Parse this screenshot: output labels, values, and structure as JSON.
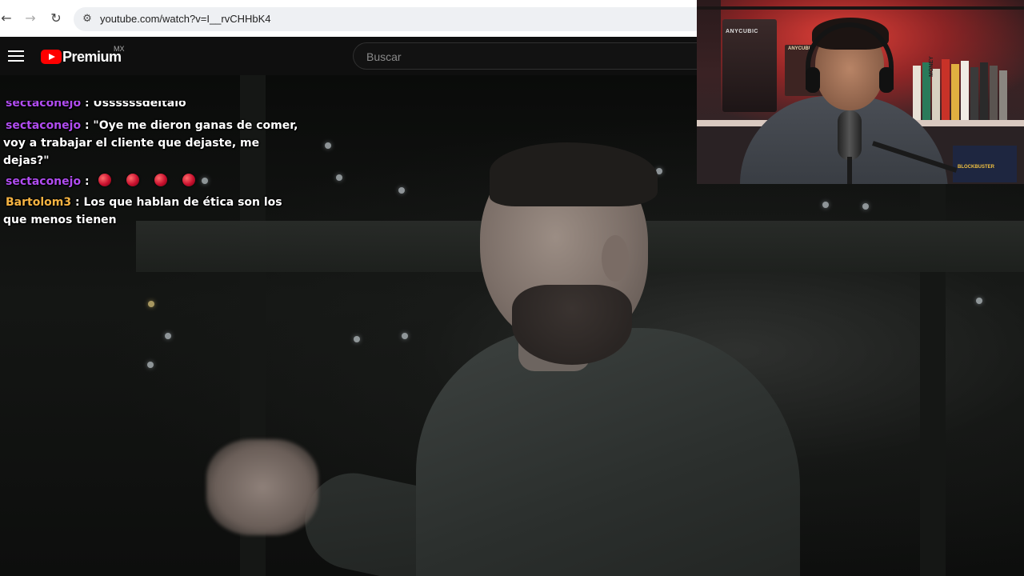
{
  "browser": {
    "back_icon": "←",
    "forward_icon": "→",
    "reload_icon": "↻",
    "site_info_icon": "⚙",
    "url": "youtube.com/watch?v=I__rvCHHbK4"
  },
  "youtube": {
    "brand": "Premium",
    "region": "MX",
    "search_placeholder": "Buscar"
  },
  "chat": {
    "messages": [
      {
        "user": "sectaconejo",
        "user_color": "#b04cf0",
        "text": ": Ussssssdeltalo"
      },
      {
        "user": "sectaconejo",
        "user_color": "#b04cf0",
        "text": ": \"Oye me dieron ganas de comer, voy a trabajar el cliente que dejaste, me dejas?\""
      },
      {
        "user": "sectaconejo",
        "user_color": "#b04cf0",
        "text": ":",
        "emote_count": 4
      },
      {
        "user": "Bartolom3",
        "user_color": "#f5b342",
        "text": ": Los que hablan de ética son los que menos tienen"
      }
    ]
  },
  "webcam": {
    "printer_label": "ANYCUBIC",
    "box_label": "ANYCUBIC",
    "book_title": "MONEY",
    "lower_label": "BLOCKBUSTER"
  },
  "colors": {
    "youtube_red": "#ff0000",
    "chat_purple": "#b04cf0",
    "chat_gold": "#f5b342",
    "header_bg": "#0f0f0f"
  }
}
